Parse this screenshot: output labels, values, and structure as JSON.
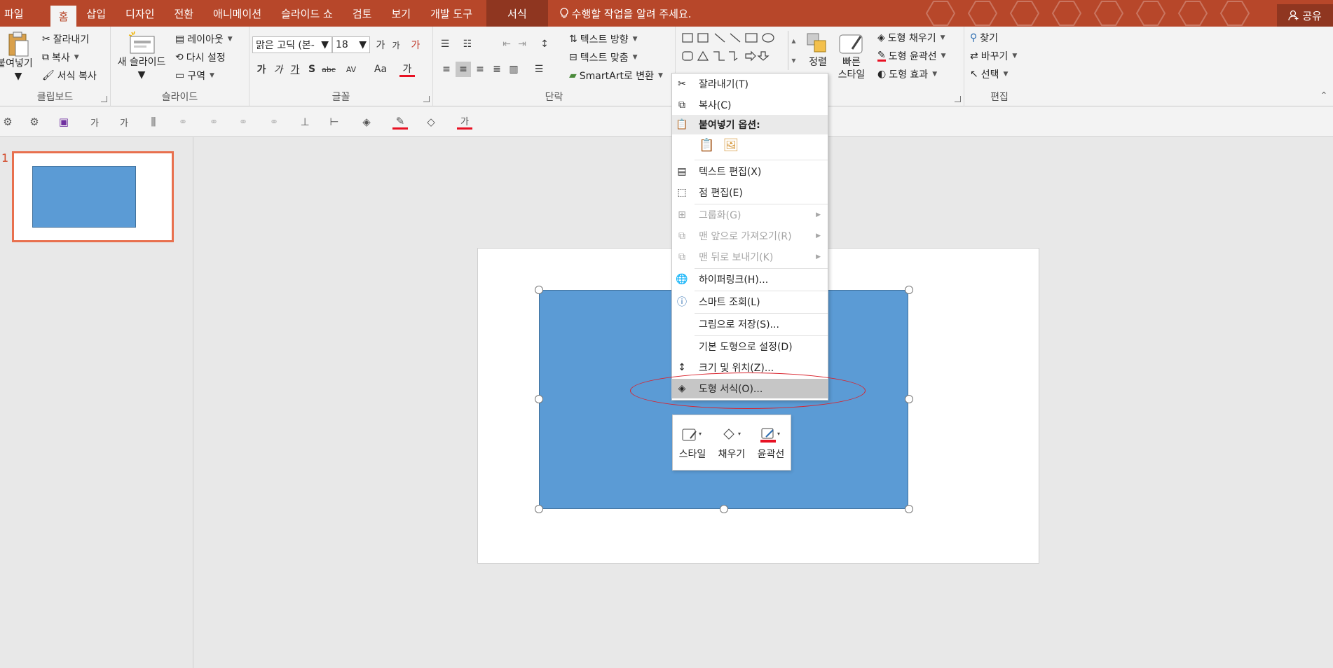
{
  "tabs": [
    "파일",
    "홈",
    "삽입",
    "디자인",
    "전환",
    "애니메이션",
    "슬라이드 쇼",
    "검토",
    "보기",
    "개발 도구",
    "서식"
  ],
  "tell_me": "수행할 작업을 알려 주세요.",
  "share": "공유",
  "clipboard": {
    "paste": "붙여넣기",
    "cut": "잘라내기",
    "copy": "복사",
    "format_painter": "서식 복사",
    "label": "클립보드"
  },
  "slides_group": {
    "new_slide": "새 슬라이드",
    "layout": "레이아웃",
    "reset": "다시 설정",
    "section": "구역",
    "label": "슬라이드"
  },
  "font_group": {
    "font_name": "맑은 고딕 (본-",
    "font_size": "18",
    "label": "글꼴",
    "bold": "가",
    "italic": "가",
    "underline": "가",
    "shadow": "S",
    "strike": "abc",
    "spacing": "AV",
    "case": "Aa",
    "color": "가",
    "grow": "가",
    "shrink": "가",
    "clear": "가"
  },
  "paragraph_group": {
    "text_direction": "텍스트 방향",
    "align_text": "텍스트 맞춤",
    "smartart": "SmartArt로 변환",
    "label": "단락"
  },
  "drawing_group": {
    "arrange": "정렬",
    "quick_styles_1": "빠른",
    "quick_styles_2": "스타일",
    "shape_fill": "도형 채우기",
    "shape_outline": "도형 윤곽선",
    "shape_effects": "도형 효과"
  },
  "editing_group": {
    "find": "찾기",
    "replace": "바꾸기",
    "select": "선택",
    "label": "편집"
  },
  "qat_glyphs": {
    "font_a": "가",
    "font_b": "가",
    "color_a": "가"
  },
  "slide_number": "1",
  "context_menu": {
    "cut": "잘라내기(T)",
    "copy": "복사(C)",
    "paste_options": "붙여넣기 옵션:",
    "edit_text": "텍스트 편집(X)",
    "edit_points": "점 편집(E)",
    "group": "그룹화(G)",
    "bring_front": "맨 앞으로 가져오기(R)",
    "send_back": "맨 뒤로 보내기(K)",
    "hyperlink": "하이퍼링크(H)...",
    "smart_lookup": "스마트 조회(L)",
    "save_picture": "그림으로 저장(S)...",
    "set_default": "기본 도형으로 설정(D)",
    "size_position": "크기 및 위치(Z)...",
    "format_shape": "도형 서식(O)..."
  },
  "mini_toolbar": {
    "style": "스타일",
    "fill": "채우기",
    "outline": "윤곽선"
  },
  "colors": {
    "accent": "#b7472a",
    "shape_fill": "#5b9bd5",
    "shape_border": "#41719c",
    "highlight_oval": "#d9232d",
    "font_red": "#e81123"
  }
}
